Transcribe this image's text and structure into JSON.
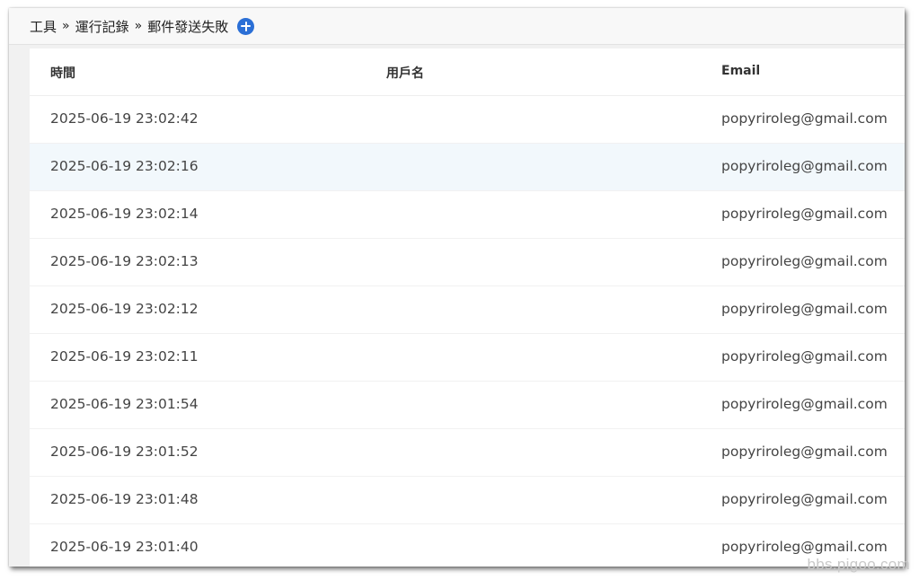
{
  "breadcrumb": {
    "items": [
      "工具",
      "運行記錄",
      "郵件發送失敗"
    ],
    "separator": "»",
    "add_icon": "plus-circle-icon",
    "accent_color": "#2b6fd6"
  },
  "table": {
    "columns": [
      "時間",
      "用戶名",
      "Email"
    ],
    "rows": [
      {
        "time": "2025-06-19 23:02:42",
        "user": "",
        "email": "popyriroleg@gmail.com"
      },
      {
        "time": "2025-06-19 23:02:16",
        "user": "",
        "email": "popyriroleg@gmail.com"
      },
      {
        "time": "2025-06-19 23:02:14",
        "user": "",
        "email": "popyriroleg@gmail.com"
      },
      {
        "time": "2025-06-19 23:02:13",
        "user": "",
        "email": "popyriroleg@gmail.com"
      },
      {
        "time": "2025-06-19 23:02:12",
        "user": "",
        "email": "popyriroleg@gmail.com"
      },
      {
        "time": "2025-06-19 23:02:11",
        "user": "",
        "email": "popyriroleg@gmail.com"
      },
      {
        "time": "2025-06-19 23:01:54",
        "user": "",
        "email": "popyriroleg@gmail.com"
      },
      {
        "time": "2025-06-19 23:01:52",
        "user": "",
        "email": "popyriroleg@gmail.com"
      },
      {
        "time": "2025-06-19 23:01:48",
        "user": "",
        "email": "popyriroleg@gmail.com"
      },
      {
        "time": "2025-06-19 23:01:40",
        "user": "",
        "email": "popyriroleg@gmail.com"
      }
    ],
    "highlight_row_color": "#f2f8fc"
  },
  "watermark": "bbs.pigoo.com"
}
